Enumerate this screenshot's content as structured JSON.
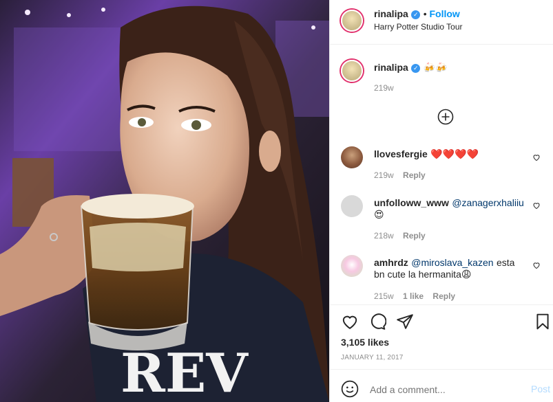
{
  "header": {
    "username": "rinalipa",
    "follow_label": "Follow",
    "location": "Harry Potter Studio Tour",
    "more_icon": "ellipsis-icon"
  },
  "caption": {
    "username": "rinalipa",
    "text": "🍻🍻",
    "time": "219w"
  },
  "load_more_icon": "plus-circle-icon",
  "comments": [
    {
      "username": "llovesfergie",
      "text": "❤️❤️❤️❤️",
      "time": "219w",
      "reply": "Reply"
    },
    {
      "username": "unfolloww_www",
      "mention": "@zanagerxhaliiu",
      "text": "😍",
      "time": "218w",
      "reply": "Reply"
    },
    {
      "username": "amhrdz",
      "mention": "@miroslava_kazen",
      "text_line1": "esta",
      "text_line2": "bn cute la hermanita😩",
      "time": "215w",
      "likes": "1 like",
      "reply": "Reply"
    }
  ],
  "actions": {
    "likes": "3,105 likes",
    "date": "JANUARY 11, 2017"
  },
  "comment_box": {
    "placeholder": "Add a comment...",
    "post_label": "Post"
  },
  "colors": {
    "accent": "#0095f6",
    "verified": "#3897f0",
    "heart_red": "#ed4956"
  }
}
